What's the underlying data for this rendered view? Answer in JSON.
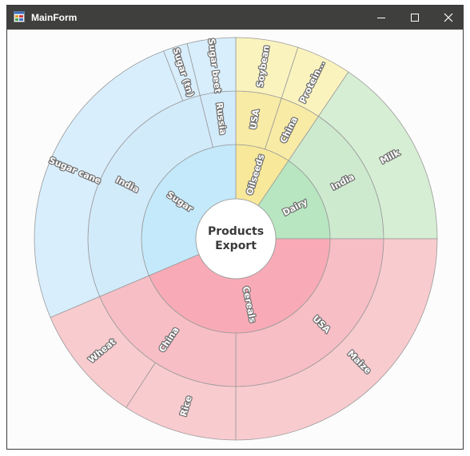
{
  "window": {
    "title": "MainForm"
  },
  "icons": {
    "app": "app-form-icon",
    "minimize": "minimize-icon",
    "maximize": "maximize-icon",
    "close": "close-icon"
  },
  "chart_data": {
    "type": "sunburst",
    "center_label": [
      "Products",
      "Export"
    ],
    "rings": [
      {
        "level": 1,
        "segments": [
          {
            "label": "Oilseeds",
            "start": 0,
            "end": 34,
            "color": "#f7e89a"
          },
          {
            "label": "Dairy",
            "start": 34,
            "end": 90,
            "color": "#b7e6c0"
          },
          {
            "label": "Cereals",
            "start": 90,
            "end": 247,
            "color": "#f8abb6"
          },
          {
            "label": "Sugar",
            "start": 247,
            "end": 360,
            "color": "#c3e9fb"
          }
        ]
      },
      {
        "level": 2,
        "segments": [
          {
            "label": "USA",
            "start": 0,
            "end": 18,
            "color": "#f8eba5"
          },
          {
            "label": "China",
            "start": 18,
            "end": 34,
            "color": "#f8eba5"
          },
          {
            "label": "India",
            "start": 34,
            "end": 90,
            "color": "#cdeacf"
          },
          {
            "label": "USA",
            "start": 90,
            "end": 180,
            "color": "#f7bec5"
          },
          {
            "label": "China",
            "start": 180,
            "end": 247,
            "color": "#f7bec5"
          },
          {
            "label": "India",
            "start": 247,
            "end": 346,
            "color": "#d2ebfb"
          },
          {
            "label": "Russia",
            "start": 346,
            "end": 360,
            "color": "#d2ebfb"
          }
        ]
      },
      {
        "level": 3,
        "segments": [
          {
            "label": "Soybean",
            "start": 0,
            "end": 18,
            "color": "#faf3be"
          },
          {
            "label": "Protein...",
            "start": 18,
            "end": 34,
            "color": "#faf3be"
          },
          {
            "label": "Milk",
            "start": 34,
            "end": 90,
            "color": "#d6eed3"
          },
          {
            "label": "Maize",
            "start": 90,
            "end": 180,
            "color": "#f8cbcf"
          },
          {
            "label": "Rice",
            "start": 180,
            "end": 213,
            "color": "#f8cbcf"
          },
          {
            "label": "Wheat",
            "start": 213,
            "end": 247,
            "color": "#f8cbcf"
          },
          {
            "label": "Sugar cane",
            "start": 247,
            "end": 339,
            "color": "#d8eefd"
          },
          {
            "label": "Sugar (tn)",
            "start": 339,
            "end": 346,
            "color": "#d8eefd"
          },
          {
            "label": "Sugar beet",
            "start": 346,
            "end": 360,
            "color": "#d8eefd"
          }
        ]
      }
    ]
  }
}
